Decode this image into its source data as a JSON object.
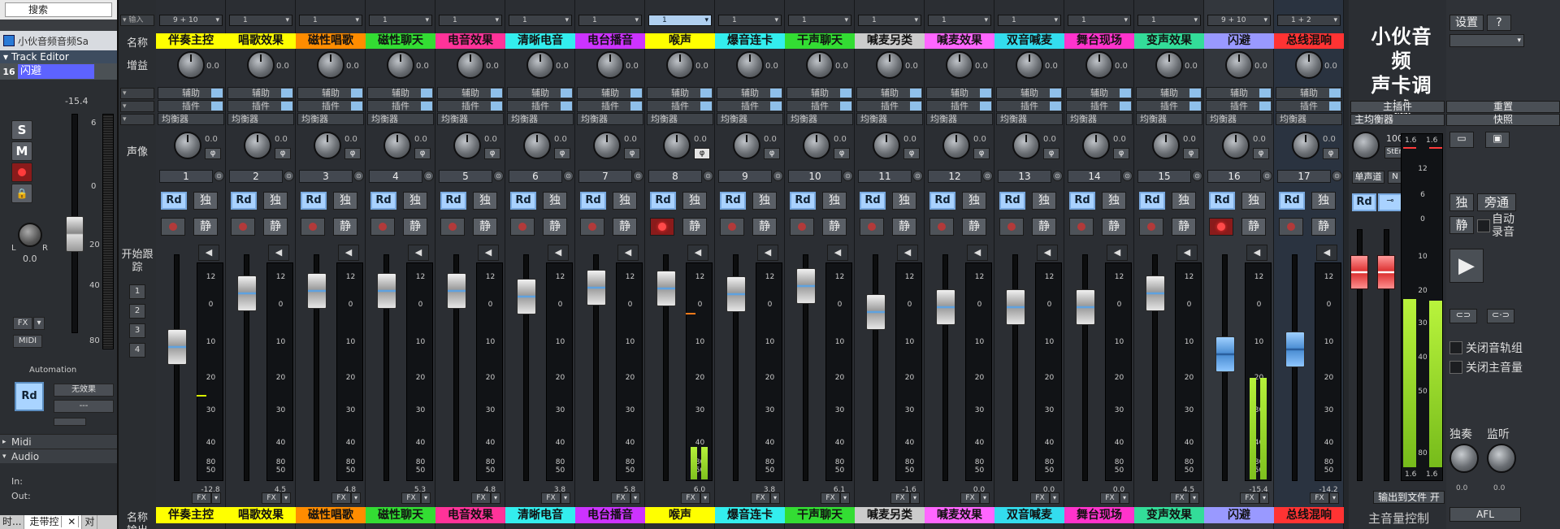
{
  "left": {
    "search_label": "搜索",
    "window_title": "小伙音频音频Sa",
    "track_editor": "Track Editor",
    "track_number": "16",
    "track_name": "闪避",
    "fader_value": "-15.4",
    "btn_s": "S",
    "btn_m": "M",
    "pan_value": "0.0",
    "pan_l": "L",
    "pan_r": "R",
    "fx_label": "FX",
    "midi_label": "MIDI",
    "automation_label": "Automation",
    "rd_label": "Rd",
    "automation_mode": "无效果",
    "automation_sub": "---",
    "meter_scale": [
      "6",
      "0",
      "20",
      "40",
      "80"
    ],
    "sections": {
      "midi": "Midi",
      "audio": "Audio",
      "in": "In:",
      "out": "Out:"
    },
    "tabs": [
      "时...",
      "走带控",
      "对"
    ]
  },
  "rows": {
    "input": "输入",
    "name": "名称",
    "gain": "增益",
    "aux": "辅助",
    "plugins": "插件",
    "eq": "均衡器",
    "pan": "声像",
    "start_tracking": "开始跟踪",
    "track_buttons": [
      "1",
      "2",
      "3",
      "4"
    ],
    "name_bottom": "名称",
    "output": "输出"
  },
  "strips": [
    {
      "num": "1",
      "name": "伴奏主控",
      "color": "#ffff00",
      "input": "9 + 10",
      "gain": "0.0",
      "pan": "0.0",
      "value": "-12.8",
      "rec": false
    },
    {
      "num": "2",
      "name": "唱歌效果",
      "color": "#ffff00",
      "input": "1",
      "gain": "0.0",
      "pan": "0.0",
      "value": "4.5",
      "rec": false
    },
    {
      "num": "3",
      "name": "磁性唱歌",
      "color": "#ff8c00",
      "input": "1",
      "gain": "0.0",
      "pan": "0.0",
      "value": "4.8",
      "rec": false
    },
    {
      "num": "4",
      "name": "磁性聊天",
      "color": "#33dd33",
      "input": "1",
      "gain": "0.0",
      "pan": "0.0",
      "value": "5.3",
      "rec": false
    },
    {
      "num": "5",
      "name": "电音效果",
      "color": "#ff3399",
      "input": "1",
      "gain": "0.0",
      "pan": "0.0",
      "value": "4.8",
      "rec": false
    },
    {
      "num": "6",
      "name": "清晰电音",
      "color": "#33eeee",
      "input": "1",
      "gain": "0.0",
      "pan": "0.0",
      "value": "3.8",
      "rec": false
    },
    {
      "num": "7",
      "name": "电台播音",
      "color": "#cc33ff",
      "input": "1",
      "gain": "0.0",
      "pan": "0.0",
      "value": "5.8",
      "rec": false
    },
    {
      "num": "8",
      "name": "喉声",
      "color": "#ffff00",
      "input": "1",
      "gain": "0.0",
      "pan": "0.0",
      "value": "6.0",
      "rec": true
    },
    {
      "num": "9",
      "name": "爆音连卡",
      "color": "#33eeee",
      "input": "1",
      "gain": "0.0",
      "pan": "0.0",
      "value": "3.8",
      "rec": false
    },
    {
      "num": "10",
      "name": "干声聊天",
      "color": "#33dd33",
      "input": "1",
      "gain": "0.0",
      "pan": "0.0",
      "value": "6.1",
      "rec": false
    },
    {
      "num": "11",
      "name": "喊麦另类",
      "color": "#cccccc",
      "input": "1",
      "gain": "0.0",
      "pan": "0.0",
      "value": "-1.6",
      "rec": false
    },
    {
      "num": "12",
      "name": "喊麦效果",
      "color": "#ff66ff",
      "input": "1",
      "gain": "0.0",
      "pan": "0.0",
      "value": "0.0",
      "rec": false
    },
    {
      "num": "13",
      "name": "双音喊麦",
      "color": "#33ddee",
      "input": "1",
      "gain": "0.0",
      "pan": "0.0",
      "value": "0.0",
      "rec": false
    },
    {
      "num": "14",
      "name": "舞台现场",
      "color": "#ff33cc",
      "input": "1",
      "gain": "0.0",
      "pan": "0.0",
      "value": "0.0",
      "rec": false
    },
    {
      "num": "15",
      "name": "变声效果",
      "color": "#33dd99",
      "input": "1",
      "gain": "0.0",
      "pan": "0.0",
      "value": "4.5",
      "rec": false
    },
    {
      "num": "16",
      "name": "闪避",
      "color": "#9999ff",
      "input": "9 + 10",
      "gain": "0.0",
      "pan": "0.0",
      "value": "-15.4",
      "rec": true
    },
    {
      "num": "17",
      "name": "总线混响",
      "color": "#ff3333",
      "input": "1 + 2",
      "gain": "0.0",
      "pan": "0.0",
      "value": "-14.2",
      "rec": false
    }
  ],
  "strip_labels": {
    "aux": "辅助",
    "plugin": "插件",
    "eq": "均衡器",
    "phi": "φ",
    "rd": "Rd",
    "solo": "独",
    "mute": "静",
    "fx": "FX"
  },
  "meter_scale": [
    "12",
    "0",
    "10",
    "20",
    "30",
    "40",
    "50",
    "80"
  ],
  "master": {
    "brand_line1": "小伙音频",
    "brand_line2": "声卡调试",
    "plugins": "主插件",
    "eq": "主均衡器",
    "pan_value": "100",
    "stereo": "StEn",
    "mono": "单声道",
    "n": "N",
    "scale_top": [
      "1.6",
      "1.6"
    ],
    "scale": [
      "12",
      "6",
      "0",
      "10",
      "20",
      "30",
      "40",
      "50",
      "80"
    ],
    "scale_bottom": [
      "1.6",
      "1.6"
    ],
    "export": "输出到文件 开",
    "volume_control": "主音量控制"
  },
  "right": {
    "settings": "设置",
    "help": "?",
    "reset_view": "重置",
    "shortcut": "快照",
    "solo": "独",
    "bypass": "旁通",
    "mute": "静",
    "auto_record": "自动录音",
    "close_group": "关闭音轨组",
    "close_master": "关闭主音量",
    "solo_knob": "独奏",
    "monitor_knob": "监听",
    "knob_a": "0.0",
    "knob_b": "0.0",
    "afl": "AFL"
  }
}
